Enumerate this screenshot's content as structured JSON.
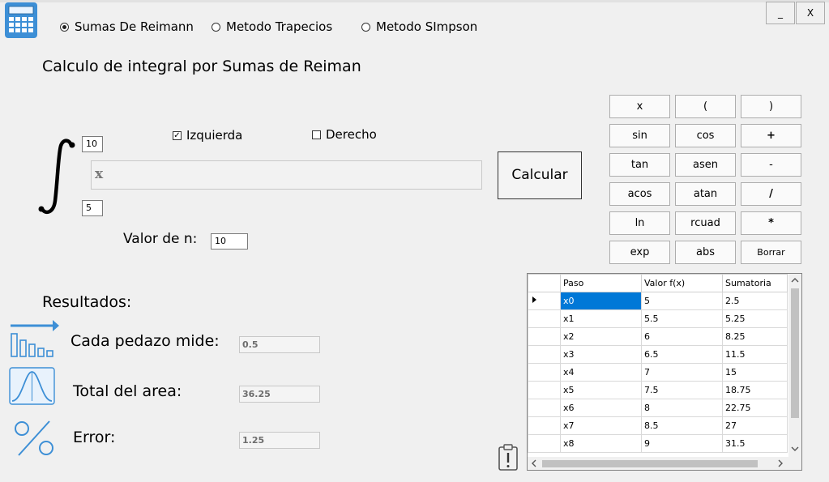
{
  "methods": {
    "riemann": "Sumas De Reimann",
    "trapecios": "Metodo Trapecios",
    "simpson": "Metodo SImpson"
  },
  "window": {
    "minimize": "_",
    "close": "X"
  },
  "title": "Calculo de integral por Sumas de Reiman",
  "integral": {
    "upper": "10",
    "lower": "5",
    "function": "x"
  },
  "options": {
    "izquierda": "Izquierda",
    "derecho": "Derecho"
  },
  "n": {
    "label": "Valor de n:",
    "value": "10"
  },
  "calcular": "Calcular",
  "keypad": [
    "x",
    "(",
    ")",
    "sin",
    "cos",
    "+",
    "tan",
    "asen",
    "-",
    "acos",
    "atan",
    "/",
    "ln",
    "rcuad",
    "*",
    "exp",
    "abs",
    "Borrar"
  ],
  "results": {
    "heading": "Resultados:",
    "piece_label": "Cada pedazo mide:",
    "piece_value": "0.5",
    "area_label": "Total del area:",
    "area_value": "36.25",
    "error_label": "Error:",
    "error_value": "1.25"
  },
  "table": {
    "headers": [
      "Paso",
      "Valor f(x)",
      "Sumatoria"
    ],
    "rows": [
      [
        "x0",
        "5",
        "2.5"
      ],
      [
        "x1",
        "5.5",
        "5.25"
      ],
      [
        "x2",
        "6",
        "8.25"
      ],
      [
        "x3",
        "6.5",
        "11.5"
      ],
      [
        "x4",
        "7",
        "15"
      ],
      [
        "x5",
        "7.5",
        "18.75"
      ],
      [
        "x6",
        "8",
        "22.75"
      ],
      [
        "x7",
        "8.5",
        "27"
      ],
      [
        "x8",
        "9",
        "31.5"
      ]
    ]
  }
}
